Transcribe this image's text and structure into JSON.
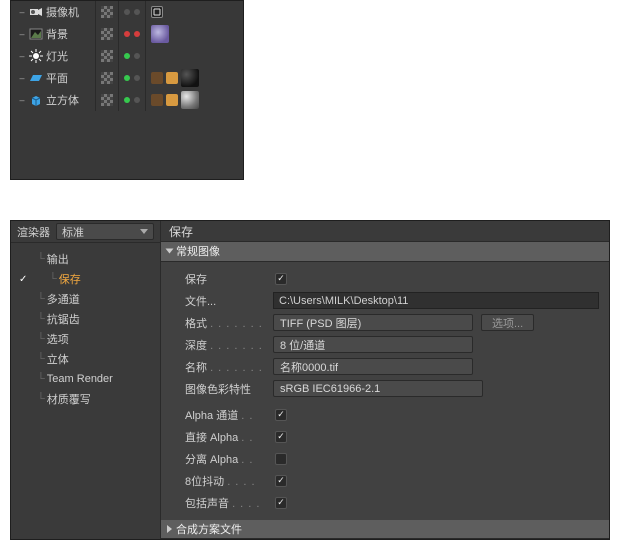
{
  "objects": {
    "items": [
      {
        "label": "摄像机"
      },
      {
        "label": "背景"
      },
      {
        "label": "灯光"
      },
      {
        "label": "平面"
      },
      {
        "label": "立方体"
      }
    ]
  },
  "renderer": {
    "label": "渲染器",
    "value": "标准"
  },
  "nav": {
    "items": [
      {
        "label": "输出",
        "checked": false
      },
      {
        "label": "保存",
        "checked": true,
        "selected": true
      },
      {
        "label": "多通道",
        "checked": false
      },
      {
        "label": "抗锯齿",
        "checked": false
      },
      {
        "label": "选项",
        "checked": false
      },
      {
        "label": "立体",
        "checked": false
      },
      {
        "label": "Team Render",
        "checked": false
      },
      {
        "label": "材质覆写",
        "checked": false
      }
    ]
  },
  "save": {
    "title": "保存",
    "section_regular": "常规图像",
    "section_compositing": "合成方案文件",
    "fields": {
      "save_label": "保存",
      "save_checked": true,
      "file_label": "文件...",
      "file_value": "C:\\Users\\MILK\\Desktop\\11",
      "format_label": "格式",
      "format_value": "TIFF (PSD 图层)",
      "options_btn": "选项...",
      "depth_label": "深度",
      "depth_value": "8 位/通道",
      "name_label": "名称",
      "name_value": "名称0000.tif",
      "profile_label": "图像色彩特性",
      "profile_value": "sRGB IEC61966-2.1",
      "alpha_label": "Alpha 通道",
      "alpha_checked": true,
      "straight_label": "直接 Alpha",
      "straight_checked": true,
      "sep_label": "分离 Alpha",
      "sep_checked": false,
      "dither_label": "8位抖动",
      "dither_checked": true,
      "sound_label": "包括声音",
      "sound_checked": true
    }
  }
}
